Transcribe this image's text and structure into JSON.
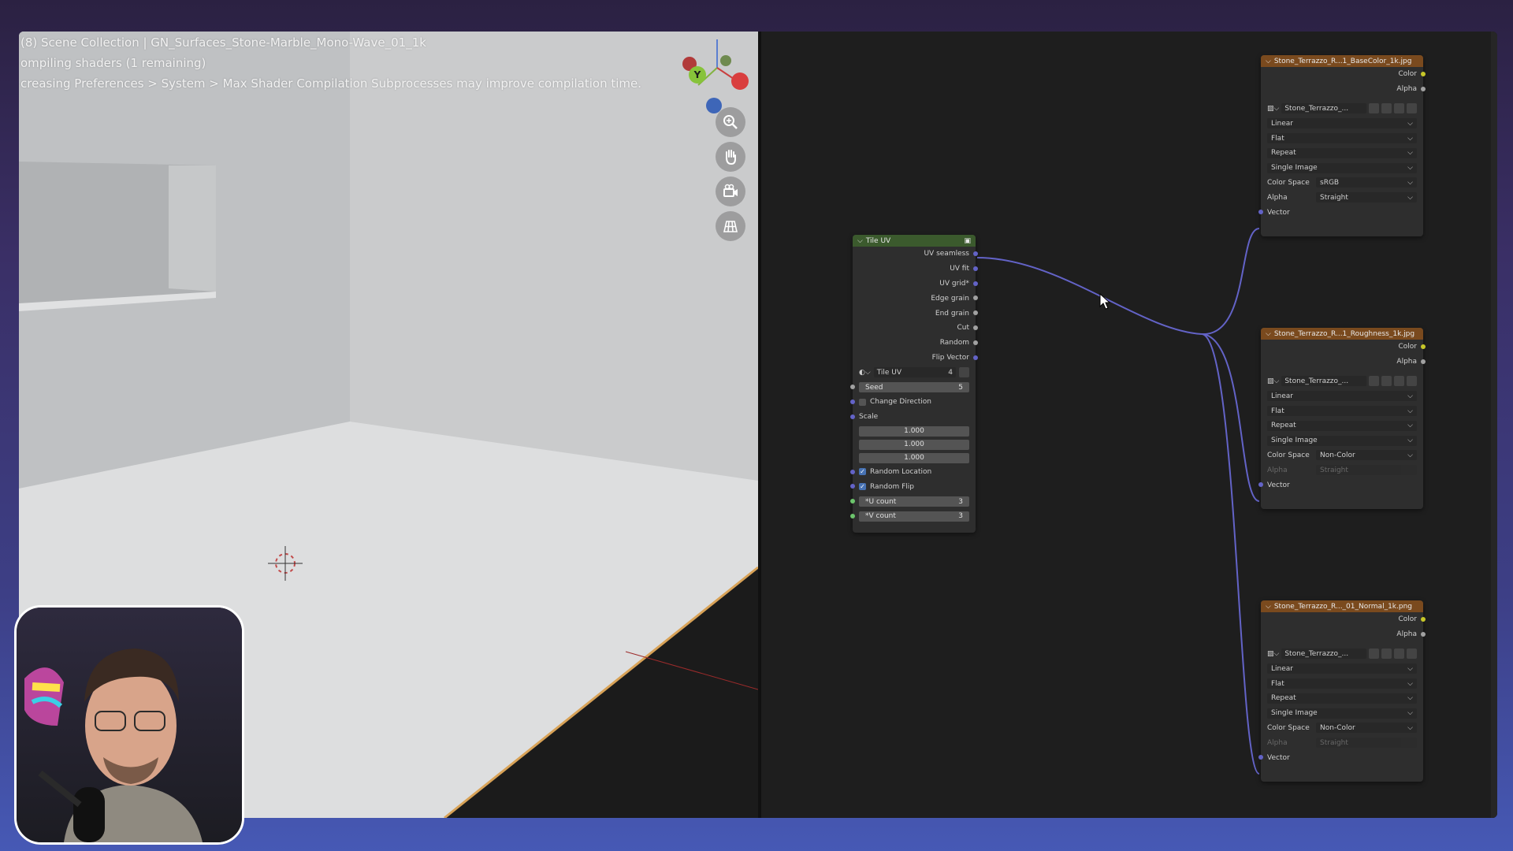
{
  "viewport": {
    "info_lines": [
      "(8) Scene Collection | GN_Surfaces_Stone-Marble_Mono-Wave_01_1k",
      "ompiling shaders (1 remaining)",
      "creasing Preferences > System > Max Shader Compilation Subprocesses may improve compilation time."
    ],
    "gizmo": {
      "y_label": "Y"
    },
    "nav_icons": [
      "zoom-icon",
      "hand-pan-icon",
      "camera-icon",
      "grid-icon"
    ]
  },
  "tile_uv_node": {
    "title": "Tile UV",
    "outputs": [
      "UV seamless",
      "UV fit",
      "UV grid*",
      "Edge grain",
      "End grain",
      "Cut",
      "Random",
      "Flip Vector"
    ],
    "group_name": "Tile UV",
    "group_users": "4",
    "seed_label": "Seed",
    "seed_value": "5",
    "change_direction": "Change Direction",
    "scale_label": "Scale",
    "scale_values": [
      "1.000",
      "1.000",
      "1.000"
    ],
    "random_location": "Random Location",
    "random_flip": "Random Flip",
    "u_count_label": "*U count",
    "u_count_value": "3",
    "v_count_label": "*V count",
    "v_count_value": "3"
  },
  "image_nodes": [
    {
      "title": "Stone_Terrazzo_R...1_BaseColor_1k.jpg",
      "image": "Stone_Terrazzo_...",
      "interpolation": "Linear",
      "projection": "Flat",
      "extension": "Repeat",
      "source": "Single Image",
      "color_space_label": "Color Space",
      "color_space": "sRGB",
      "alpha_label": "Alpha",
      "alpha": "Straight",
      "out_color": "Color",
      "out_alpha": "Alpha",
      "in_vector": "Vector"
    },
    {
      "title": "Stone_Terrazzo_R...1_Roughness_1k.jpg",
      "image": "Stone_Terrazzo_...",
      "interpolation": "Linear",
      "projection": "Flat",
      "extension": "Repeat",
      "source": "Single Image",
      "color_space_label": "Color Space",
      "color_space": "Non-Color",
      "alpha_label": "Alpha",
      "alpha": "Straight",
      "out_color": "Color",
      "out_alpha": "Alpha",
      "in_vector": "Vector"
    },
    {
      "title": "Stone_Terrazzo_R..._01_Normal_1k.png",
      "image": "Stone_Terrazzo_...",
      "interpolation": "Linear",
      "projection": "Flat",
      "extension": "Repeat",
      "source": "Single Image",
      "color_space_label": "Color Space",
      "color_space": "Non-Color",
      "alpha_label": "Alpha",
      "alpha": "Straight",
      "out_color": "Color",
      "out_alpha": "Alpha",
      "in_vector": "Vector"
    }
  ],
  "colors": {
    "link": "#6363c7",
    "node_header_group": "#3b5a2d",
    "node_header_texture": "#7a4a1e",
    "frame_gradient_top": "#2b2142",
    "frame_gradient_bottom": "#4659b5"
  }
}
